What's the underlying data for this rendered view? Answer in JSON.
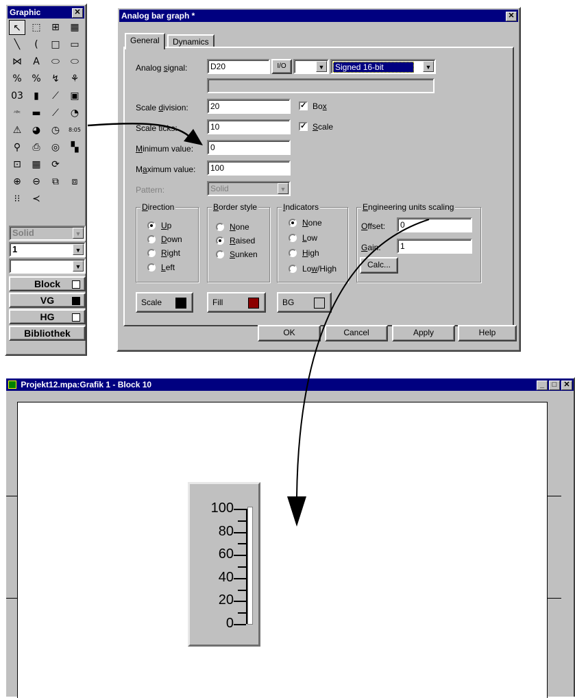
{
  "palette": {
    "title": "Graphic",
    "tools": [
      "arrow-select",
      "rect-select",
      "region-select",
      "group-select",
      "line",
      "arc",
      "rectangle",
      "rounded-rectangle",
      "polyline",
      "text",
      "ellipse",
      "filled-ellipse",
      "analog-text",
      "analog-value",
      "chart",
      "trend",
      "text-field",
      "bar",
      "plot",
      "screen",
      "abc-field",
      "slider",
      "curve",
      "gauge",
      "alarm",
      "pie",
      "clock",
      "digital-clock",
      "indicator",
      "display",
      "target",
      "object",
      "block",
      "table",
      "prompt",
      "",
      "zoom-in",
      "zoom-out",
      "copy",
      "paste",
      "grid",
      "curve-tool"
    ],
    "pattern_value": "Solid",
    "line_width_value": "1",
    "line_style_value": "",
    "buttons": [
      {
        "label": "Block",
        "swatch": "#ffffff"
      },
      {
        "label": "VG",
        "swatch": "#000000"
      },
      {
        "label": "HG",
        "swatch": "#ffffff"
      }
    ],
    "library_label": "Bibliothek"
  },
  "dialog": {
    "title": "Analog bar graph *",
    "tabs": [
      "General",
      "Dynamics"
    ],
    "analog_signal_label": "Analog signal:",
    "analog_signal_value": "D20",
    "io_button": "I/O",
    "type_value": "Signed 16-bit",
    "scale_division_label": "Scale division:",
    "scale_division_value": "20",
    "scale_ticks_label": "Scale ticks:",
    "scale_ticks_value": "10",
    "box_label": "Box",
    "scale_check_label": "Scale",
    "minimum_label": "Minimum value:",
    "minimum_value": "0",
    "maximum_label": "Maximum value:",
    "maximum_value": "100",
    "pattern_label": "Pattern:",
    "pattern_value": "Solid",
    "direction": {
      "title": "Direction",
      "options": [
        "Up",
        "Down",
        "Right",
        "Left"
      ],
      "selected": 0
    },
    "border_style": {
      "title": "Border style",
      "options": [
        "None",
        "Raised",
        "Sunken"
      ],
      "selected": 1
    },
    "indicators": {
      "title": "Indicators",
      "options": [
        "None",
        "Low",
        "High",
        "Low/High"
      ],
      "selected": 0
    },
    "scaling": {
      "title": "Engineering units scaling",
      "offset_label": "Offset:",
      "offset_value": "0",
      "gain_label": "Gain:",
      "gain_value": "1",
      "calc_label": "Calc..."
    },
    "colors": [
      {
        "label": "Scale",
        "swatch": "#000000"
      },
      {
        "label": "Fill",
        "swatch": "#8b0000"
      },
      {
        "label": "BG",
        "swatch": "#c0c0c0"
      }
    ],
    "buttons": {
      "ok": "OK",
      "cancel": "Cancel",
      "apply": "Apply",
      "help": "Help"
    }
  },
  "project_window": {
    "title": "Projekt12.mpa:Grafik 1 - Block 10",
    "bar_graph": {
      "scale_labels": [
        "100",
        "80",
        "60",
        "40",
        "20",
        "0"
      ],
      "fill_fraction": 0
    }
  }
}
